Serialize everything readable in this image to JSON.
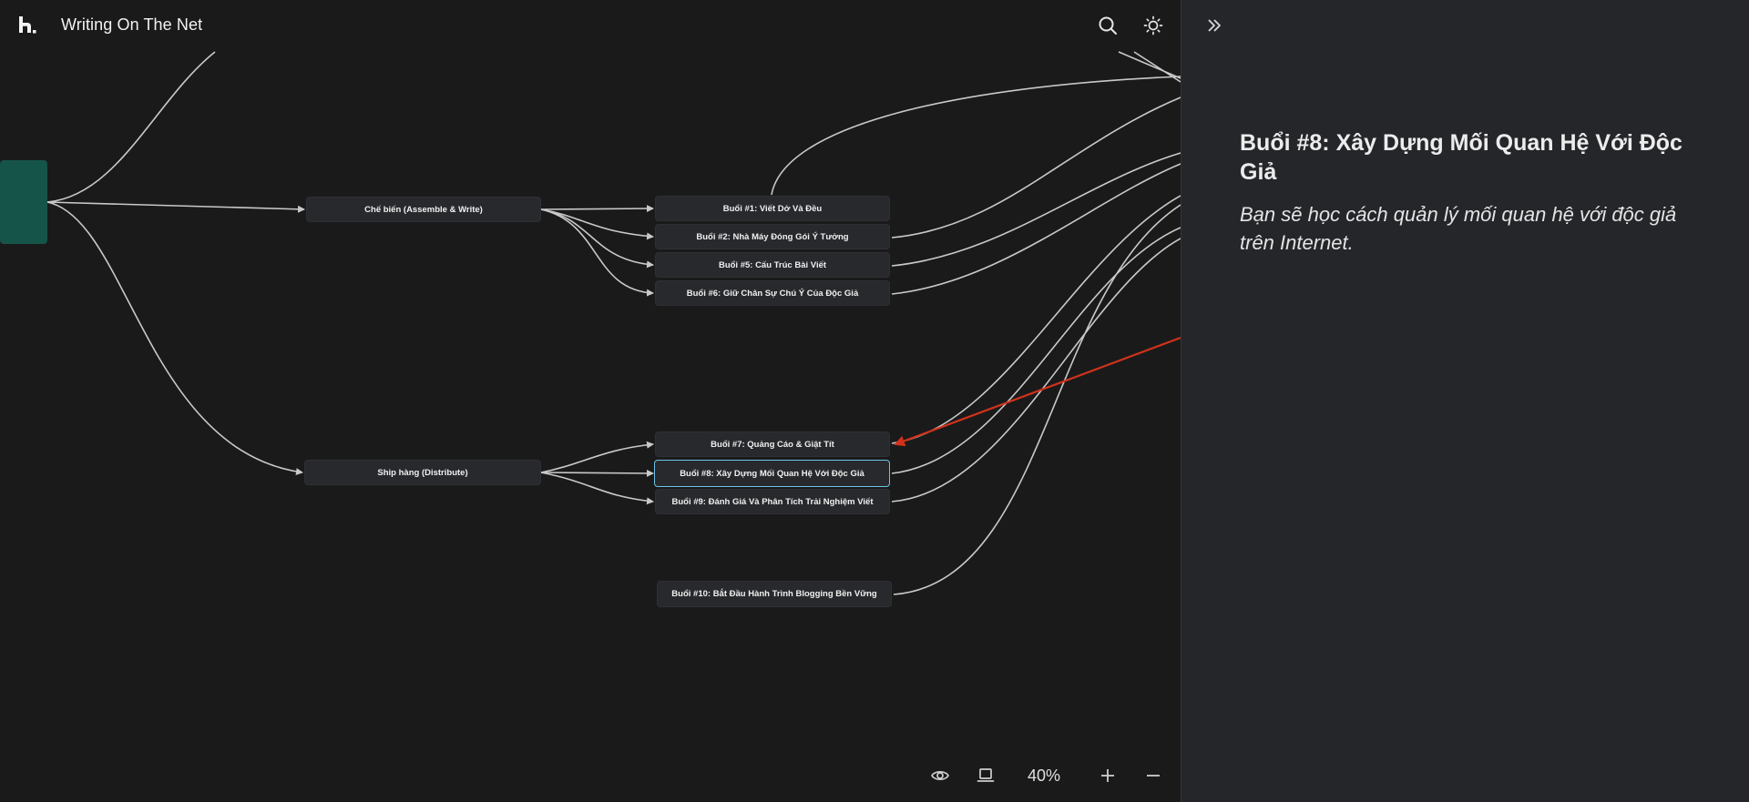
{
  "app": {
    "title": "Writing On The Net",
    "logo_icon": "hackmd-logo-icon",
    "header_actions": [
      "search-icon",
      "sun-icon"
    ]
  },
  "mindmap": {
    "root": {
      "label": "",
      "color": "#155449"
    },
    "branches": [
      {
        "id": "assemble",
        "label": "Chế biến (Assemble & Write)"
      },
      {
        "id": "distribute",
        "label": "Ship hàng (Distribute)"
      }
    ],
    "lessons": [
      {
        "id": "b1",
        "label": "Buổi #1: Viết Dở Và Đều"
      },
      {
        "id": "b2",
        "label": "Buổi #2: Nhà Máy Đóng Gói Ý Tưởng"
      },
      {
        "id": "b5",
        "label": "Buổi #5: Cấu Trúc Bài Viết"
      },
      {
        "id": "b6",
        "label": "Buổi #6: Giữ Chân Sự Chú Ý Của Độc Giả"
      },
      {
        "id": "b7",
        "label": "Buổi #7: Quảng Cáo & Giật Tít"
      },
      {
        "id": "b8",
        "label": "Buổi #8: Xây Dựng Mối Quan Hệ Với Độc Giả",
        "selected": true
      },
      {
        "id": "b9",
        "label": "Buổi #9: Đánh Giá Và Phân Tích Trải Nghiệm Viết"
      },
      {
        "id": "b10",
        "label": "Buổi #10: Bắt Đầu Hành Trình Blogging Bền Vững"
      }
    ],
    "edge_color": "#c9c9c9",
    "highlight_arrow_color": "#d0321b"
  },
  "toolbar": {
    "icons": [
      "eye-icon",
      "presentation-icon",
      "zoom-in-icon",
      "zoom-out-icon"
    ],
    "zoom_label": "40%"
  },
  "detail_panel": {
    "collapse_icon": "double-chevron-right-icon",
    "title": "Buổi #8: Xây Dựng Mối Quan Hệ Với Độc Giả",
    "description": "Bạn sẽ học cách quản lý mối quan hệ với độc giả trên Internet."
  }
}
